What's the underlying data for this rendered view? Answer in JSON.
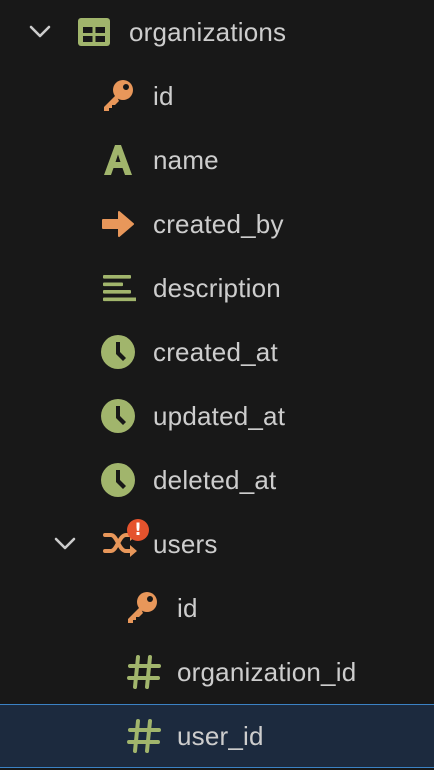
{
  "tree": {
    "table": {
      "label": "organizations",
      "expanded": true,
      "icon": "table-icon",
      "columns": [
        {
          "label": "id",
          "icon": "key-icon"
        },
        {
          "label": "name",
          "icon": "text-type-icon"
        },
        {
          "label": "created_by",
          "icon": "foreign-key-arrow-icon"
        },
        {
          "label": "description",
          "icon": "long-text-icon"
        },
        {
          "label": "created_at",
          "icon": "clock-icon"
        },
        {
          "label": "updated_at",
          "icon": "clock-icon"
        },
        {
          "label": "deleted_at",
          "icon": "clock-icon"
        }
      ]
    },
    "relation": {
      "label": "users",
      "expanded": true,
      "icon": "relation-shuffle-icon",
      "badge": "!",
      "columns": [
        {
          "label": "id",
          "icon": "key-icon"
        },
        {
          "label": "organization_id",
          "icon": "hash-icon"
        },
        {
          "label": "user_id",
          "icon": "hash-icon",
          "selected": true
        }
      ]
    }
  },
  "colors": {
    "background": "#181818",
    "text": "#cccccc",
    "green": "#a1b56c",
    "orange": "#e8975a",
    "badge": "#e5532d",
    "selection_bg": "#1c2a3e",
    "selection_border": "#3b82c4"
  }
}
